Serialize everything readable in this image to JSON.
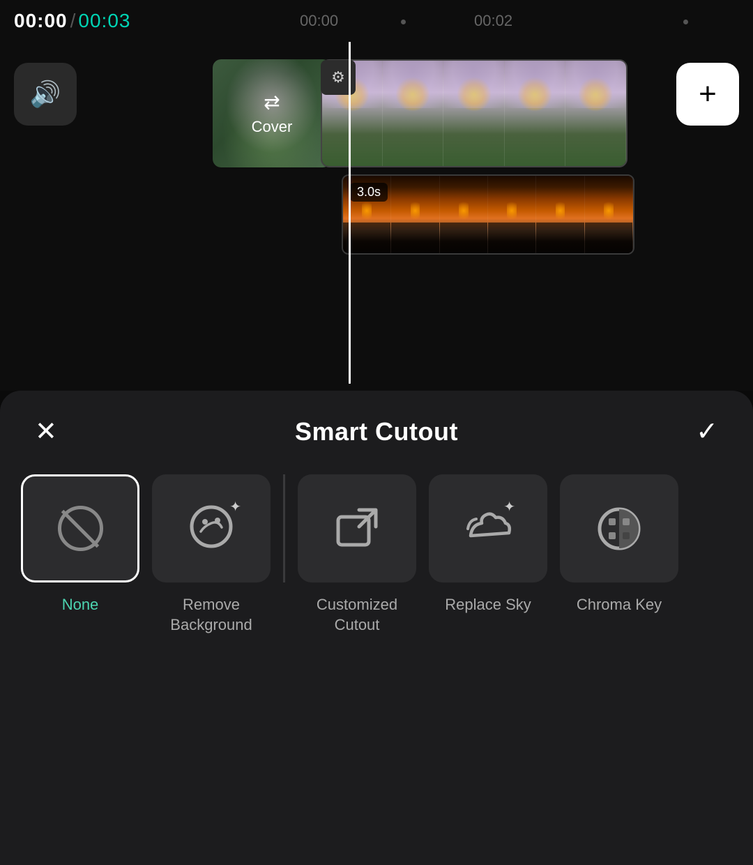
{
  "timeline": {
    "time_current": "00:00",
    "time_separator": "/",
    "time_total": "00:03",
    "marker_left": "00:00",
    "marker_right": "00:02",
    "duration_badge": "3.0s"
  },
  "controls": {
    "audio_label": "audio",
    "cover_label": "Cover",
    "add_label": "+"
  },
  "panel": {
    "title": "Smart Cutout",
    "close_label": "✕",
    "confirm_label": "✓",
    "options": [
      {
        "id": "none",
        "label": "None",
        "selected": true
      },
      {
        "id": "remove-background",
        "label": "Remove Background",
        "selected": false
      },
      {
        "id": "customized-cutout",
        "label": "Customized Cutout",
        "selected": false
      },
      {
        "id": "replace-sky",
        "label": "Replace Sky",
        "selected": false
      },
      {
        "id": "chroma-key",
        "label": "Chroma Key",
        "selected": false
      }
    ]
  }
}
